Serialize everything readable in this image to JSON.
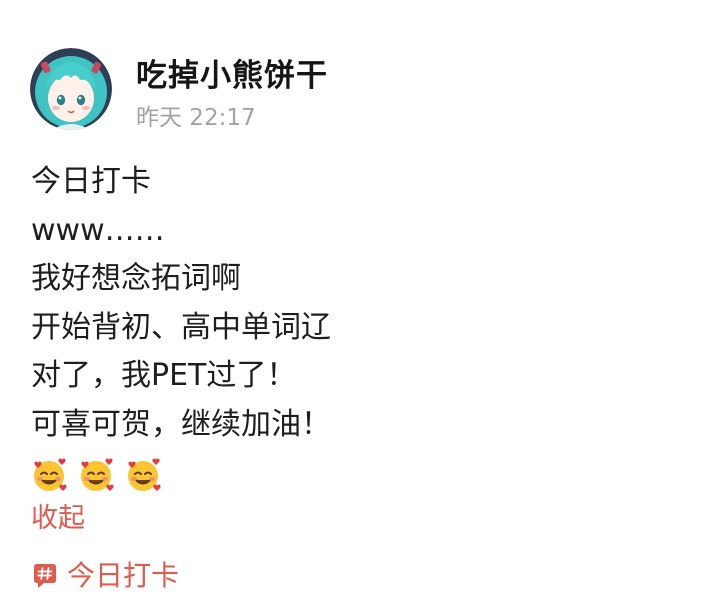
{
  "post": {
    "author": "吃掉小熊饼干",
    "timestamp": "昨天 22:17",
    "lines": [
      "今日打卡",
      "www……",
      "我好想念拓词啊",
      "开始背初、高中单词辽",
      "对了，我PET过了！",
      "可喜可贺，继续加油！"
    ],
    "emojis": [
      "smiling-face-with-hearts-icon",
      "smiling-face-with-hearts-icon",
      "smiling-face-with-hearts-icon"
    ],
    "collapse_label": "收起",
    "topic": {
      "icon": "hashtag-icon",
      "label": "今日打卡"
    }
  },
  "colors": {
    "accent": "#e05a4e",
    "text": "#1e1e1e",
    "muted": "#a3a3a3",
    "background": "#ffffff"
  }
}
